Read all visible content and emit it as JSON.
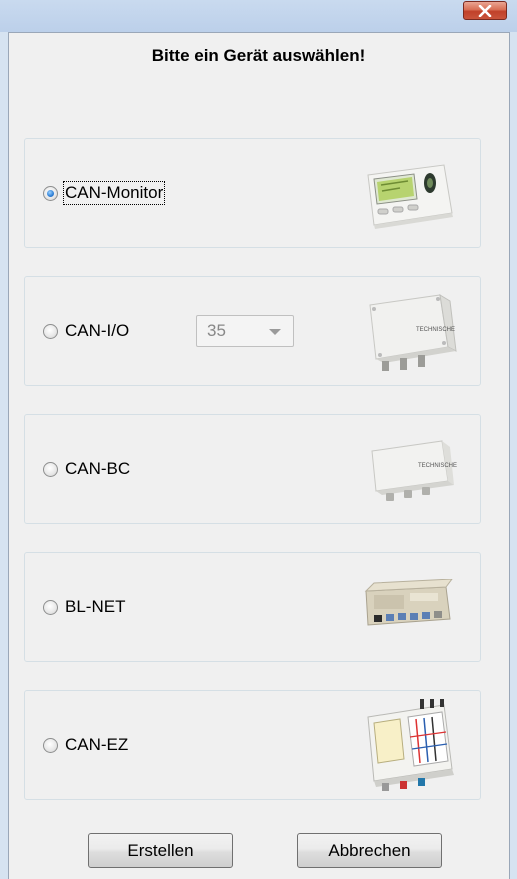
{
  "window": {
    "close_icon": "close-icon"
  },
  "heading": "Bitte ein Gerät auswählen!",
  "devices": [
    {
      "label": "CAN-Monitor",
      "checked": true,
      "focused": true,
      "image": "can-monitor-device"
    },
    {
      "label": "CAN-I/O",
      "checked": false,
      "focused": false,
      "image": "can-io-device",
      "combo_value": "35"
    },
    {
      "label": "CAN-BC",
      "checked": false,
      "focused": false,
      "image": "can-bc-device"
    },
    {
      "label": "BL-NET",
      "checked": false,
      "focused": false,
      "image": "bl-net-device"
    },
    {
      "label": "CAN-EZ",
      "checked": false,
      "focused": false,
      "image": "can-ez-device"
    }
  ],
  "buttons": {
    "create_label": "Erstellen",
    "cancel_label": "Abbrechen"
  },
  "colors": {
    "close_button": "#c9543b",
    "radio_selected": "#2e7fd6"
  }
}
